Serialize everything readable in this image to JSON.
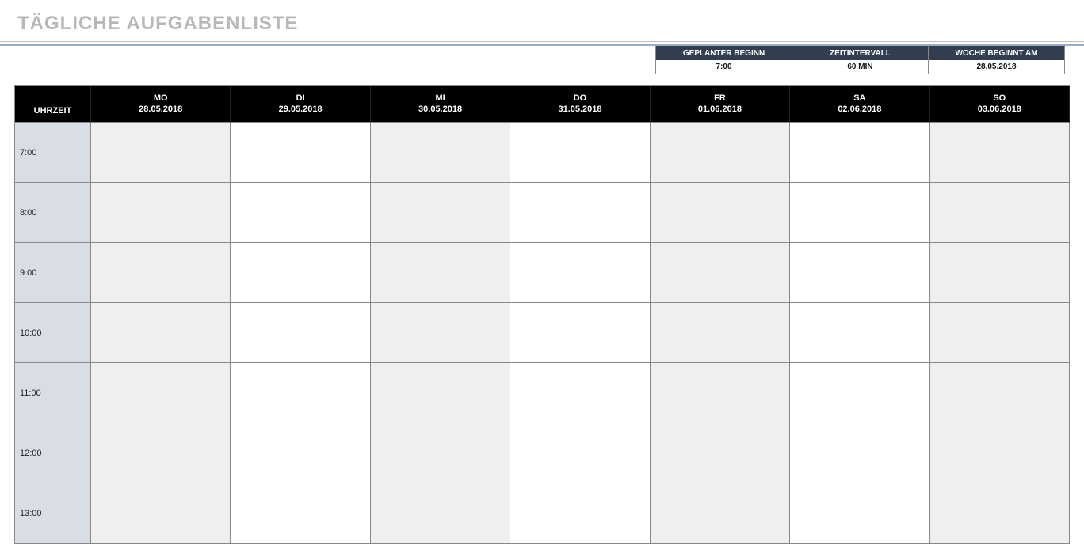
{
  "title": "TÄGLICHE AUFGABENLISTE",
  "meta": {
    "headers": {
      "start": "GEPLANTER BEGINN",
      "interval": "ZEITINTERVALL",
      "week": "WOCHE BEGINNT AM"
    },
    "values": {
      "start": "7:00",
      "interval": "60 MIN",
      "week": "28.05.2018"
    }
  },
  "schedule": {
    "time_header": "UHRZEIT",
    "days": [
      {
        "dow": "MO",
        "date": "28.05.2018"
      },
      {
        "dow": "DI",
        "date": "29.05.2018"
      },
      {
        "dow": "MI",
        "date": "30.05.2018"
      },
      {
        "dow": "DO",
        "date": "31.05.2018"
      },
      {
        "dow": "FR",
        "date": "01.06.2018"
      },
      {
        "dow": "SA",
        "date": "02.06.2018"
      },
      {
        "dow": "SO",
        "date": "03.06.2018"
      }
    ],
    "hours": [
      "7:00",
      "8:00",
      "9:00",
      "10:00",
      "11:00",
      "12:00",
      "13:00"
    ]
  }
}
